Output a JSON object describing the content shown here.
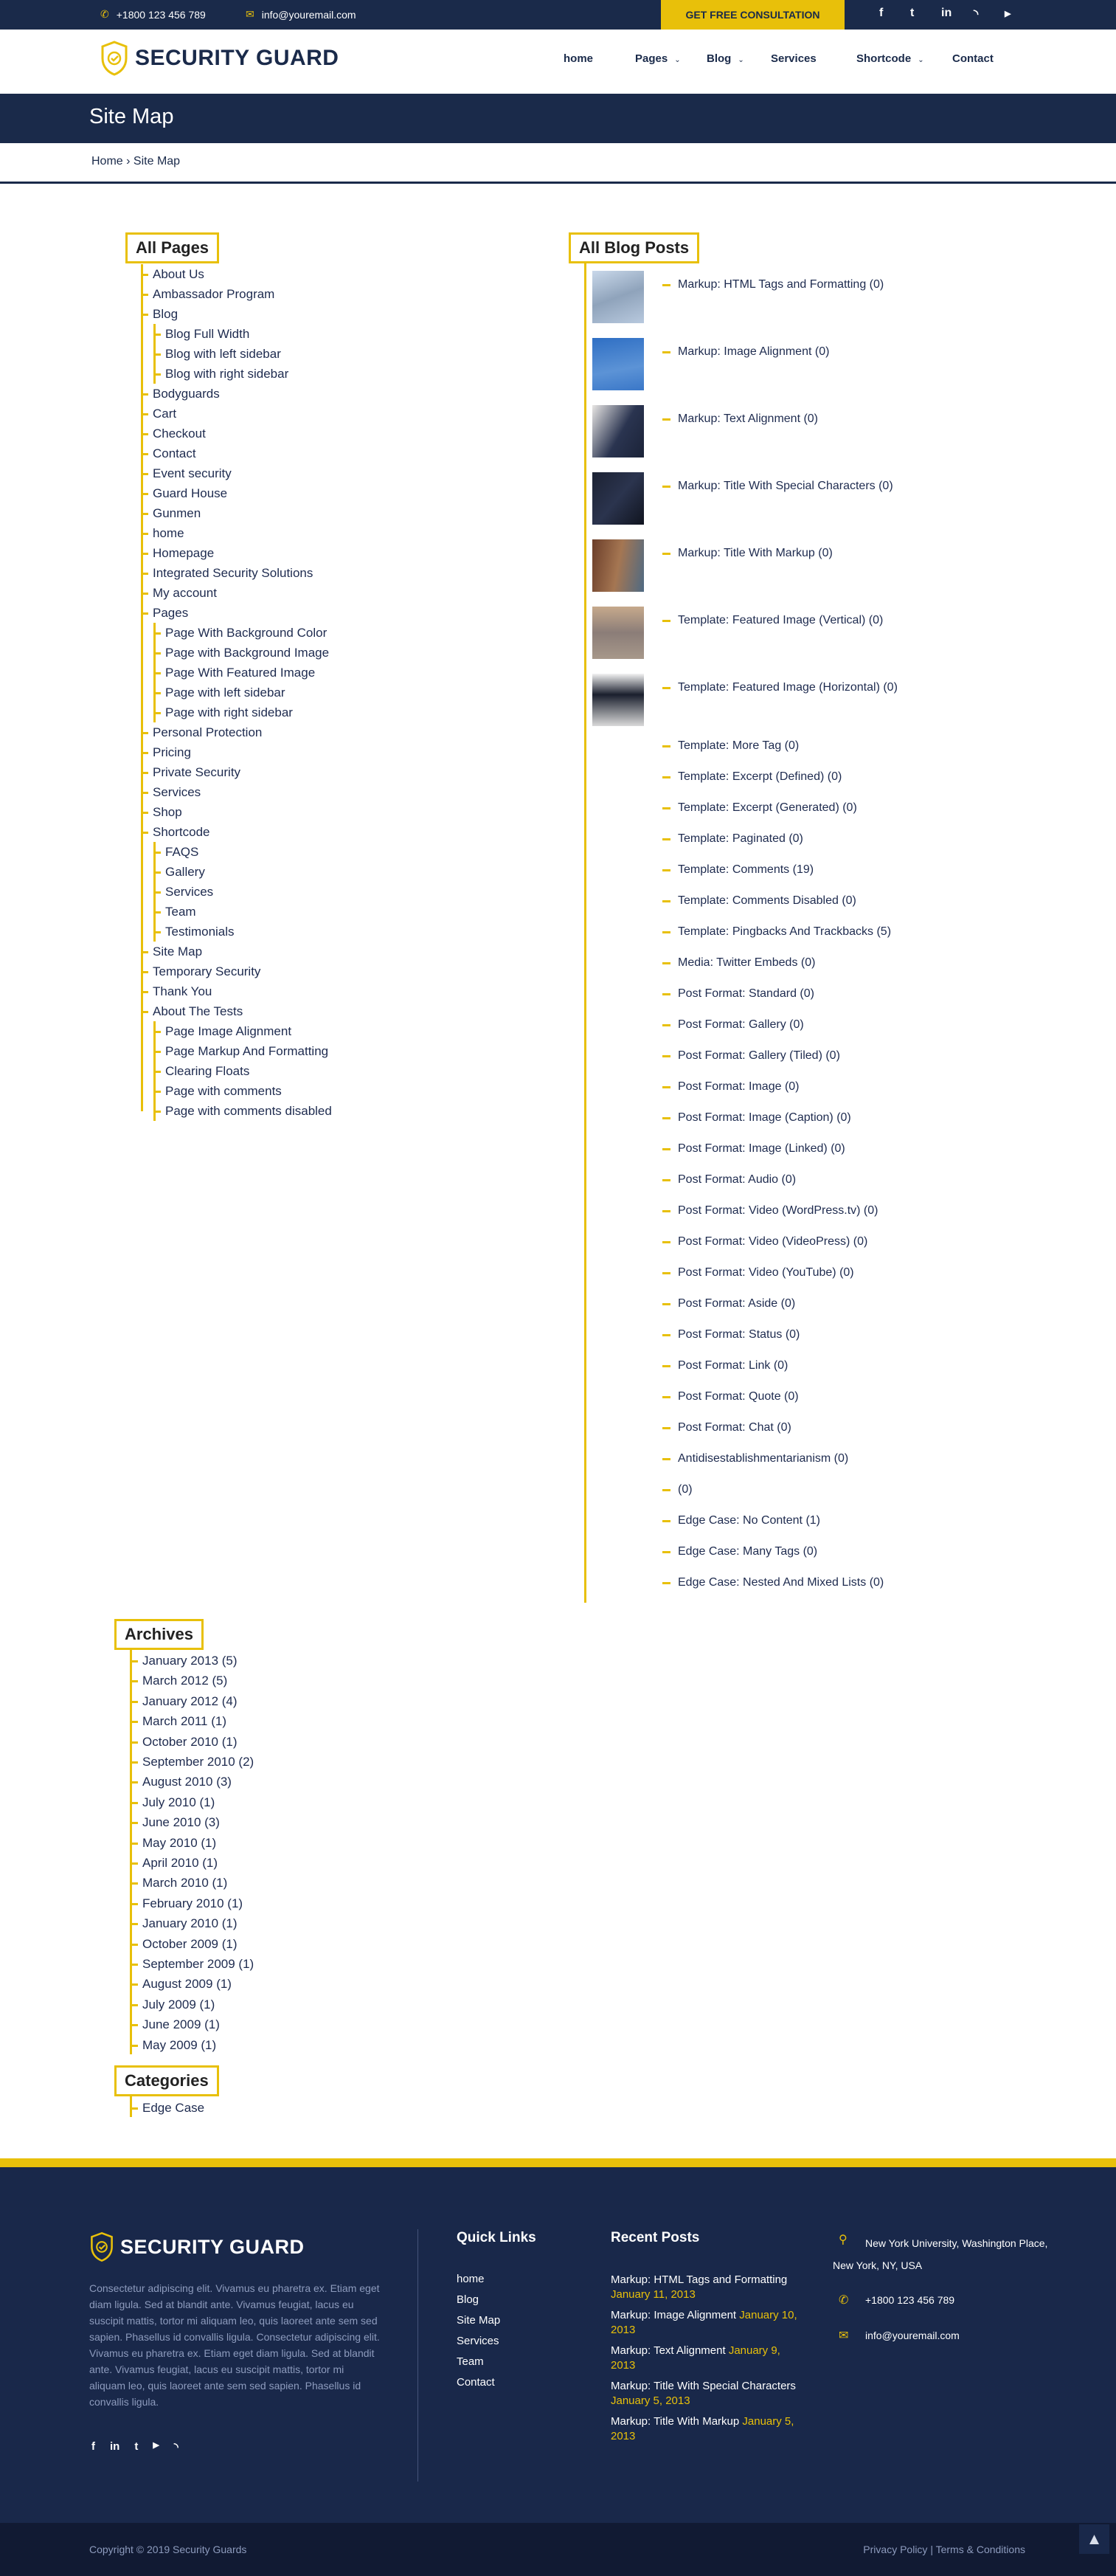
{
  "topbar": {
    "phone": "+1800 123 456 789",
    "email": "info@youremail.com",
    "cta": "GET FREE CONSULTATION",
    "social": [
      "facebook-icon",
      "twitter-icon",
      "linkedin-icon",
      "rss-icon",
      "youtube-icon"
    ]
  },
  "header": {
    "logo": "SECURITY GUARD",
    "nav": [
      {
        "label": "home",
        "dropdown": false
      },
      {
        "label": "Pages",
        "dropdown": true
      },
      {
        "label": "Blog",
        "dropdown": true
      },
      {
        "label": "Services",
        "dropdown": false
      },
      {
        "label": "Shortcode",
        "dropdown": true
      },
      {
        "label": "Contact",
        "dropdown": false
      }
    ]
  },
  "banner": {
    "title": "Site Map"
  },
  "breadcrumb": {
    "home": "Home",
    "sep": "›",
    "current": "Site Map"
  },
  "pages": {
    "title": "All Pages",
    "items": [
      {
        "label": "About Us"
      },
      {
        "label": "Ambassador Program"
      },
      {
        "label": "Blog",
        "children": [
          "Blog Full Width",
          "Blog with left sidebar",
          "Blog with right sidebar"
        ]
      },
      {
        "label": "Bodyguards"
      },
      {
        "label": "Cart"
      },
      {
        "label": "Checkout"
      },
      {
        "label": "Contact"
      },
      {
        "label": "Event security"
      },
      {
        "label": "Guard House"
      },
      {
        "label": "Gunmen"
      },
      {
        "label": "home"
      },
      {
        "label": "Homepage"
      },
      {
        "label": "Integrated Security Solutions"
      },
      {
        "label": "My account"
      },
      {
        "label": "Pages",
        "children": [
          "Page With Background Color",
          "Page with Background Image",
          "Page With Featured Image",
          "Page with left sidebar",
          "Page with right sidebar"
        ]
      },
      {
        "label": "Personal Protection"
      },
      {
        "label": "Pricing"
      },
      {
        "label": "Private Security"
      },
      {
        "label": "Services"
      },
      {
        "label": "Shop"
      },
      {
        "label": "Shortcode",
        "children": [
          "FAQS",
          "Gallery",
          "Services",
          "Team",
          "Testimonials"
        ]
      },
      {
        "label": "Site Map"
      },
      {
        "label": "Temporary Security"
      },
      {
        "label": "Thank You"
      },
      {
        "label": "About The Tests",
        "children": [
          "Page Image Alignment",
          "Page Markup And Formatting",
          "Clearing Floats",
          "Page with comments",
          "Page with comments disabled"
        ]
      }
    ]
  },
  "posts": {
    "title": "All Blog Posts",
    "with_images": [
      "Markup: HTML Tags and Formatting (0)",
      "Markup: Image Alignment (0)",
      "Markup: Text Alignment (0)",
      "Markup: Title With Special Characters (0)",
      "Markup: Title With Markup (0)",
      "Template: Featured Image (Vertical) (0)",
      "Template: Featured Image (Horizontal) (0)"
    ],
    "items": [
      "Template: More Tag (0)",
      "Template: Excerpt (Defined) (0)",
      "Template: Excerpt (Generated) (0)",
      "Template: Paginated (0)",
      "Template: Comments (19)",
      "Template: Comments Disabled (0)",
      "Template: Pingbacks And Trackbacks (5)",
      "Media: Twitter Embeds (0)",
      "Post Format: Standard (0)",
      "Post Format: Gallery (0)",
      "Post Format: Gallery (Tiled) (0)",
      "Post Format: Image (0)",
      "Post Format: Image (Caption) (0)",
      "Post Format: Image (Linked) (0)",
      "Post Format: Audio (0)",
      "Post Format: Video (WordPress.tv) (0)",
      "Post Format: Video (VideoPress) (0)",
      "Post Format: Video (YouTube) (0)",
      "Post Format: Aside (0)",
      "Post Format: Status (0)",
      "Post Format: Link (0)",
      "Post Format: Quote (0)",
      "Post Format: Chat (0)",
      "Antidisestablishmentarianism (0)",
      "(0)",
      "Edge Case: No Content (1)",
      "Edge Case: Many Tags (0)",
      "Edge Case: Nested And Mixed Lists (0)"
    ]
  },
  "archives": {
    "title": "Archives",
    "items": [
      "January 2013 (5)",
      "March 2012 (5)",
      "January 2012 (4)",
      "March 2011 (1)",
      "October 2010 (1)",
      "September 2010 (2)",
      "August 2010 (3)",
      "July 2010 (1)",
      "June 2010 (3)",
      "May 2010 (1)",
      "April 2010 (1)",
      "March 2010 (1)",
      "February 2010 (1)",
      "January 2010 (1)",
      "October 2009 (1)",
      "September 2009 (1)",
      "August 2009 (1)",
      "July 2009 (1)",
      "June 2009 (1)",
      "May 2009 (1)"
    ]
  },
  "categories": {
    "title": "Categories",
    "items": [
      "Edge Case"
    ]
  },
  "footer": {
    "logo": "SECURITY GUARD",
    "about": "Consectetur adipiscing elit. Vivamus eu pharetra ex. Etiam eget diam ligula. Sed at blandit ante. Vivamus feugiat, lacus eu suscipit mattis, tortor mi aliquam leo, quis laoreet ante sem sed sapien. Phasellus id convallis ligula. Consectetur adipiscing elit. Vivamus eu pharetra ex. Etiam eget diam ligula. Sed at blandit ante. Vivamus feugiat, lacus eu suscipit mattis, tortor mi aliquam leo, quis laoreet ante sem sed sapien. Phasellus id convallis ligula.",
    "social": [
      "facebook-icon",
      "linkedin-icon",
      "twitter-icon",
      "youtube-icon",
      "rss-icon"
    ],
    "quick_links_title": "Quick Links",
    "quick_links": [
      "home",
      "Blog",
      "Site Map",
      "Services",
      "Team",
      "Contact"
    ],
    "recent_title": "Recent Posts",
    "recent": [
      {
        "title": "Markup: HTML Tags and Formatting",
        "date": "January 11, 2013"
      },
      {
        "title": "Markup: Image Alignment",
        "date": "January 10, 2013"
      },
      {
        "title": "Markup: Text Alignment",
        "date": "January 9, 2013"
      },
      {
        "title": "Markup: Title With Special Characters",
        "date": "January 5, 2013"
      },
      {
        "title": "Markup: Title With Markup",
        "date": "January 5, 2013"
      }
    ],
    "address": "New York University, Washington Place, New York, NY, USA",
    "phone": "+1800 123 456 789",
    "email": "info@youremail.com",
    "copyright": "Copyright © 2019 Security Guards",
    "privacy": "Privacy Policy",
    "sep": "|",
    "terms": "Terms & Conditions"
  },
  "colors": {
    "navy": "#1a2a4a",
    "accent": "#e8c00a",
    "bottom": "#111a33"
  }
}
